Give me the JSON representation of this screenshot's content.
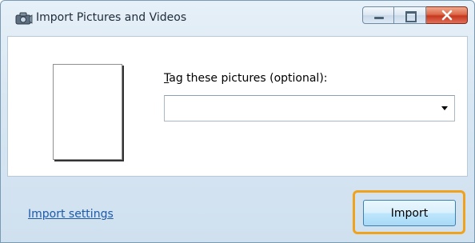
{
  "window": {
    "title": "Import Pictures and Videos",
    "app_icon": "camera-icon",
    "controls": {
      "minimize_icon": "minimize-icon",
      "maximize_icon": "maximize-icon",
      "close_icon": "close-icon"
    }
  },
  "main": {
    "tag_label_accel": "T",
    "tag_label_rest": "ag these pictures (optional):",
    "tag_value": "",
    "dropdown_icon": "chevron-down-icon"
  },
  "footer": {
    "settings_link": "Import settings",
    "import_button": "Import",
    "highlight_color": "#f0a21c"
  }
}
